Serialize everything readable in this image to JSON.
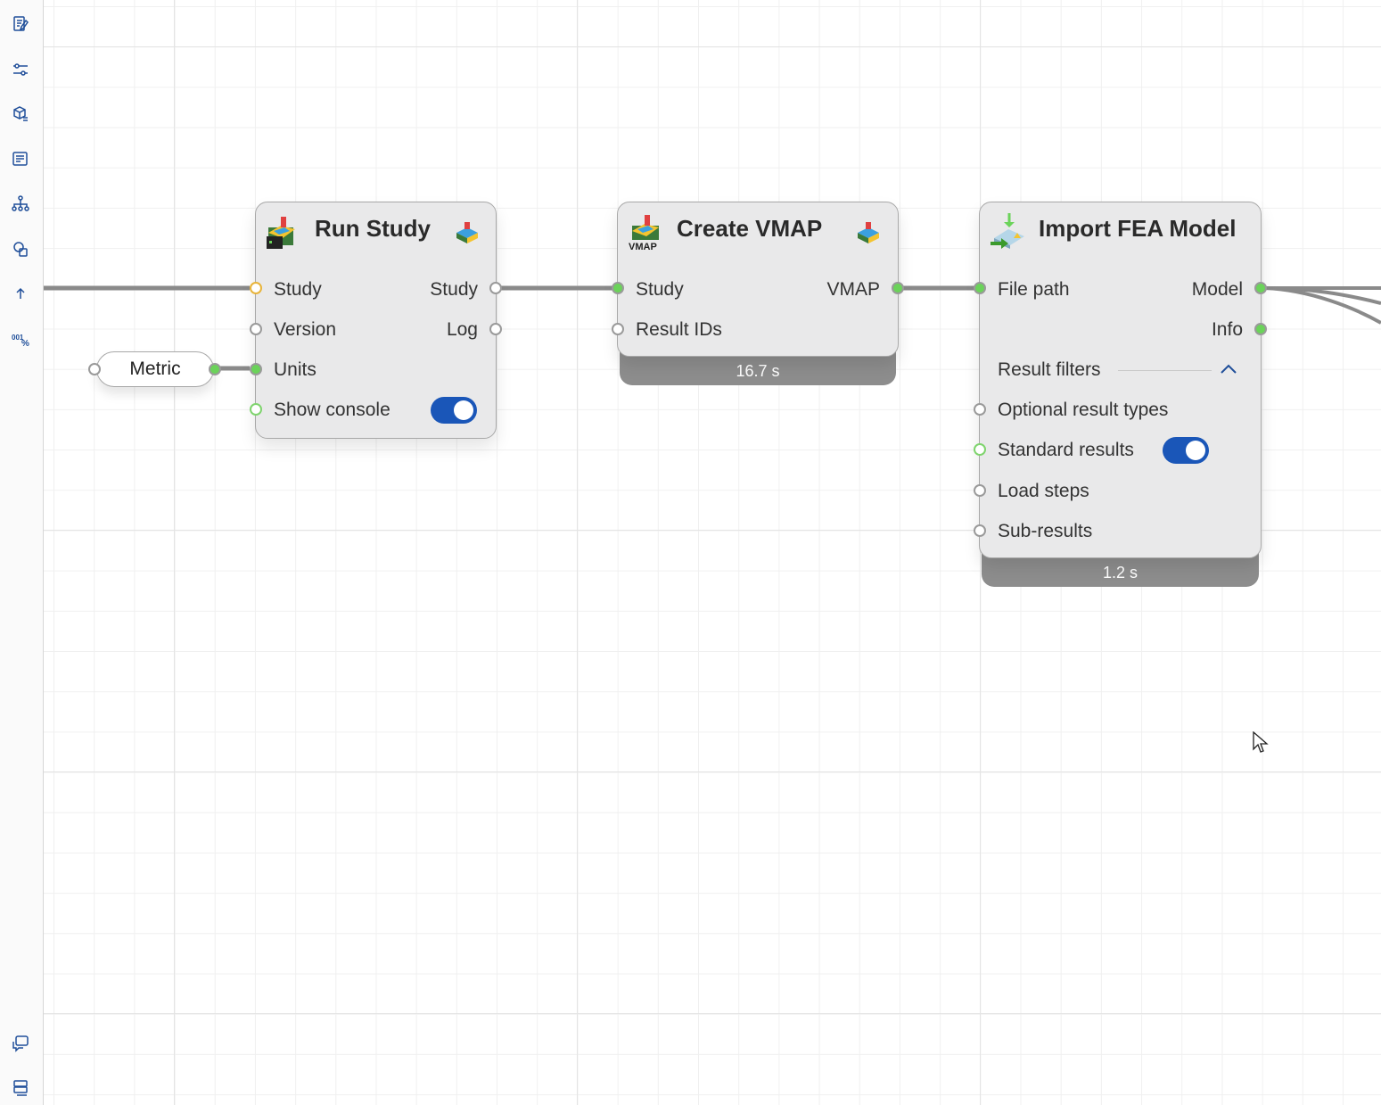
{
  "sidebar": {
    "top_icons": [
      "notes-edit-icon",
      "sliders-icon",
      "cube-list-icon",
      "document-list-icon",
      "hierarchy-icon",
      "shapes-icon",
      "arrow-up-icon",
      "percent-format-icon"
    ],
    "bottom_icons": [
      "chat-comment-icon",
      "database-output-icon"
    ]
  },
  "nodes": {
    "metric": {
      "label": "Metric"
    },
    "run_study": {
      "title": "Run Study",
      "inputs": [
        "Study",
        "Version",
        "Units",
        "Show console"
      ],
      "outputs": [
        "Study",
        "Log"
      ],
      "show_console_toggle": "on"
    },
    "create_vmap": {
      "title": "Create VMAP",
      "icon_text": "VMAP",
      "inputs": [
        "Study",
        "Result IDs"
      ],
      "outputs": [
        "VMAP"
      ],
      "time": "16.7 s"
    },
    "import_fea": {
      "title": "Import FEA Model",
      "inputs": [
        "File path"
      ],
      "outputs": [
        "Model",
        "Info"
      ],
      "section": "Result filters",
      "filters": [
        "Optional result types",
        "Standard results",
        "Load steps",
        "Sub-results"
      ],
      "standard_results_toggle": "on",
      "time": "1.2 s"
    }
  },
  "colors": {
    "accent_blue": "#1a56b8",
    "port_green": "#6bd35a",
    "port_yellow": "#e8b43a",
    "wire": "#8a8a8a"
  }
}
